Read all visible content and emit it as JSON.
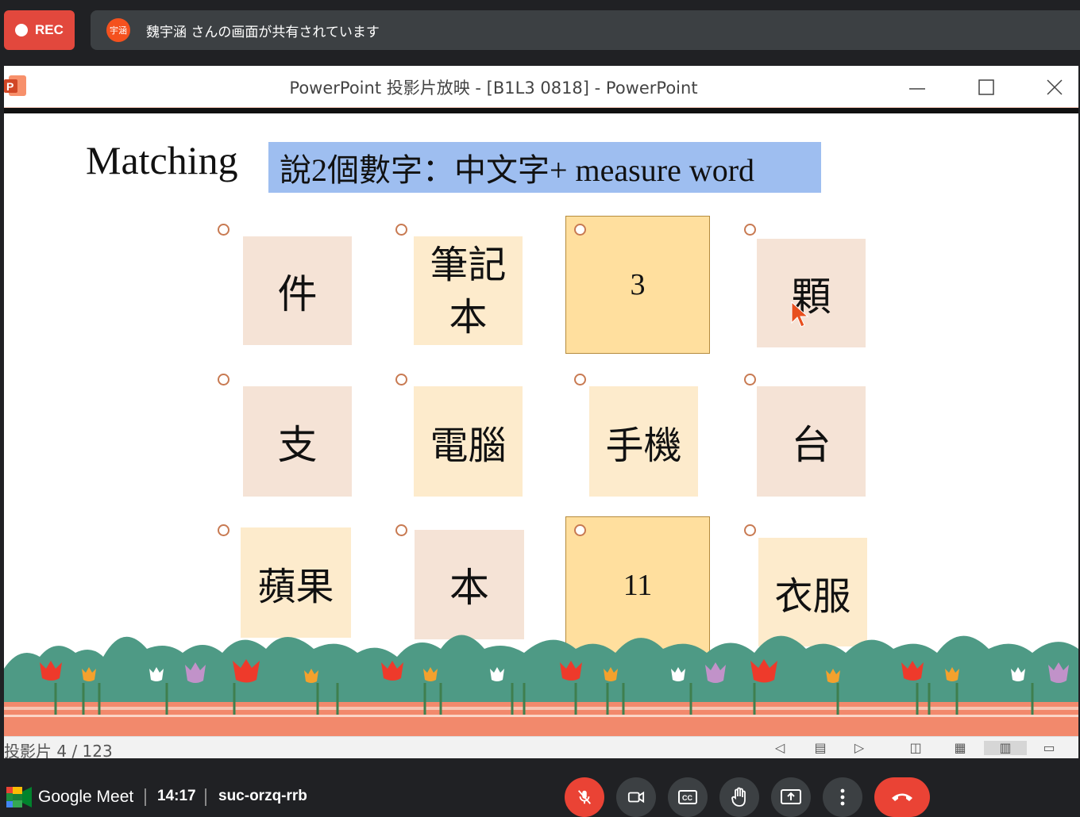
{
  "rec": {
    "label": "REC"
  },
  "share": {
    "avatar": "宇涵",
    "text": "魏宇涵 さんの画面が共有されています"
  },
  "window": {
    "title": "PowerPoint 投影片放映 - [B1L3 0818] - PowerPoint"
  },
  "slide": {
    "title": "Matching",
    "instruction": "說2個數字：中文字+ measure word",
    "cards": [
      {
        "text": "件"
      },
      {
        "text": "筆記本"
      },
      {
        "text": "3"
      },
      {
        "text": "顆"
      },
      {
        "text": "支"
      },
      {
        "text": "電腦"
      },
      {
        "text": "手機"
      },
      {
        "text": "台"
      },
      {
        "text": "蘋果"
      },
      {
        "text": "本"
      },
      {
        "text": "11"
      },
      {
        "text": "衣服"
      }
    ]
  },
  "status": {
    "slide_indicator": "投影片 4 / 123"
  },
  "meet": {
    "brand": "Google Meet",
    "time": "14:17",
    "code": "suc-orzq-rrb"
  },
  "colors": {
    "accent_red": "#ea4335",
    "control_gray": "#3c4043",
    "card_gold": "#ffdf9e",
    "instruction_blue": "#9ebef0"
  }
}
